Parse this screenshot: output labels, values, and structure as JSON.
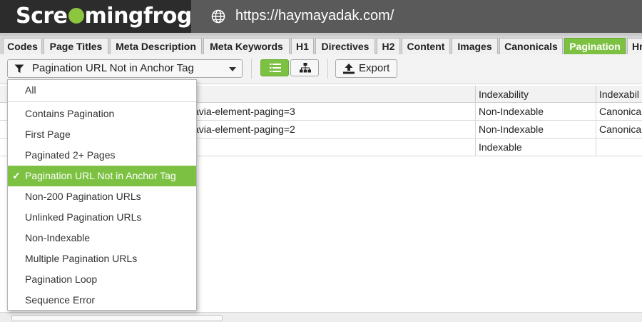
{
  "header": {
    "logo_left": "Scre",
    "logo_right": "mingfrog",
    "url": "https://haymayadak.com/"
  },
  "tabs": [
    "Codes",
    "Page Titles",
    "Meta Description",
    "Meta Keywords",
    "H1",
    "Directives",
    "H2",
    "Content",
    "Images",
    "Canonicals",
    "Pagination",
    "Hr"
  ],
  "active_tab": "Pagination",
  "toolbar": {
    "filter_value": "Pagination URL Not in Anchor Tag",
    "export_label": "Export"
  },
  "table": {
    "headers": [
      "Indexability",
      "Indexabil"
    ],
    "rows": [
      {
        "url": "avia-element-paging=3",
        "indexability": "Non-Indexable",
        "status": "Canonica"
      },
      {
        "url": "avia-element-paging=2",
        "indexability": "Non-Indexable",
        "status": "Canonica"
      },
      {
        "url": "",
        "indexability": "Indexable",
        "status": ""
      }
    ]
  },
  "dropdown": {
    "items": [
      "All",
      "Contains Pagination",
      "First Page",
      "Paginated 2+ Pages",
      "Pagination URL Not in Anchor Tag",
      "Non-200 Pagination URLs",
      "Unlinked Pagination URLs",
      "Non-Indexable",
      "Multiple Pagination URLs",
      "Pagination Loop",
      "Sequence Error"
    ],
    "check_mark": "✓"
  },
  "colors": {
    "accent": "#7cc142",
    "header_dark": "#2c2c2c",
    "url_bar": "#5a5a5a"
  }
}
